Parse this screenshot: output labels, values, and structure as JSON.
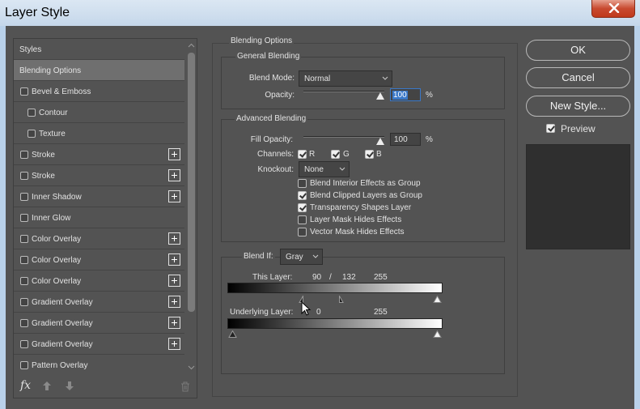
{
  "window": {
    "title": "Layer Style"
  },
  "left_panel": {
    "header": "Styles",
    "items": [
      {
        "label": "Blending Options",
        "checkbox": false,
        "plus": false,
        "indent": false,
        "selected": true
      },
      {
        "label": "Bevel & Emboss",
        "checkbox": true,
        "plus": false,
        "indent": false,
        "selected": false
      },
      {
        "label": "Contour",
        "checkbox": true,
        "plus": false,
        "indent": true,
        "selected": false
      },
      {
        "label": "Texture",
        "checkbox": true,
        "plus": false,
        "indent": true,
        "selected": false
      },
      {
        "label": "Stroke",
        "checkbox": true,
        "plus": true,
        "indent": false,
        "selected": false
      },
      {
        "label": "Stroke",
        "checkbox": true,
        "plus": true,
        "indent": false,
        "selected": false
      },
      {
        "label": "Inner Shadow",
        "checkbox": true,
        "plus": true,
        "indent": false,
        "selected": false
      },
      {
        "label": "Inner Glow",
        "checkbox": true,
        "plus": false,
        "indent": false,
        "selected": false
      },
      {
        "label": "Color Overlay",
        "checkbox": true,
        "plus": true,
        "indent": false,
        "selected": false
      },
      {
        "label": "Color Overlay",
        "checkbox": true,
        "plus": true,
        "indent": false,
        "selected": false
      },
      {
        "label": "Color Overlay",
        "checkbox": true,
        "plus": true,
        "indent": false,
        "selected": false
      },
      {
        "label": "Gradient Overlay",
        "checkbox": true,
        "plus": true,
        "indent": false,
        "selected": false
      },
      {
        "label": "Gradient Overlay",
        "checkbox": true,
        "plus": true,
        "indent": false,
        "selected": false
      },
      {
        "label": "Gradient Overlay",
        "checkbox": true,
        "plus": true,
        "indent": false,
        "selected": false
      },
      {
        "label": "Pattern Overlay",
        "checkbox": true,
        "plus": false,
        "indent": false,
        "selected": false
      }
    ],
    "footer": {
      "fx_label": "fx",
      "icons": [
        "fx-icon",
        "move-up-icon",
        "move-down-icon",
        "trash-icon"
      ]
    }
  },
  "blending": {
    "section_title": "Blending Options",
    "general": {
      "title": "General Blending",
      "blend_mode_label": "Blend Mode:",
      "blend_mode_value": "Normal",
      "opacity_label": "Opacity:",
      "opacity_value": "100",
      "opacity_unit": "%"
    },
    "advanced": {
      "title": "Advanced Blending",
      "fill_opacity_label": "Fill Opacity:",
      "fill_opacity_value": "100",
      "fill_opacity_unit": "%",
      "channels_label": "Channels:",
      "channels": [
        {
          "label": "R",
          "checked": true
        },
        {
          "label": "G",
          "checked": true
        },
        {
          "label": "B",
          "checked": true
        }
      ],
      "knockout_label": "Knockout:",
      "knockout_value": "None",
      "options": [
        {
          "label": "Blend Interior Effects as Group",
          "checked": false
        },
        {
          "label": "Blend Clipped Layers as Group",
          "checked": true
        },
        {
          "label": "Transparency Shapes Layer",
          "checked": true
        },
        {
          "label": "Layer Mask Hides Effects",
          "checked": false
        },
        {
          "label": "Vector Mask Hides Effects",
          "checked": false
        }
      ]
    },
    "blend_if": {
      "label": "Blend If:",
      "channel_value": "Gray",
      "this_layer_label": "This Layer:",
      "this_layer_low": "90",
      "this_layer_sep": "/",
      "this_layer_low2": "132",
      "this_layer_high": "255",
      "underlying_label": "Underlying Layer:",
      "underlying_low": "0",
      "underlying_high": "255"
    }
  },
  "right_panel": {
    "ok_label": "OK",
    "cancel_label": "Cancel",
    "new_style_label": "New Style...",
    "preview_label": "Preview",
    "preview_checked": true
  }
}
